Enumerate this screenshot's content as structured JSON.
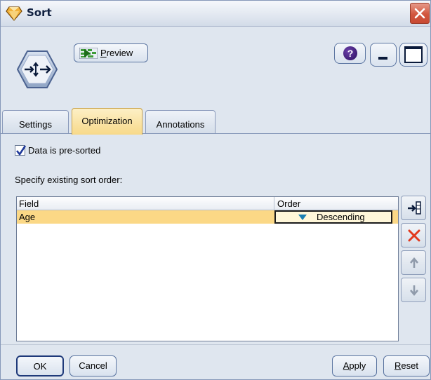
{
  "window": {
    "title": "Sort",
    "icon": "sort-node-icon",
    "close_icon": "close-icon"
  },
  "toolbar": {
    "preview_label_prefix": "",
    "preview_label_underlined": "P",
    "preview_label_rest": "review",
    "help_glyph": "?"
  },
  "tabs": [
    {
      "label": "Settings",
      "active": false
    },
    {
      "label": "Optimization",
      "active": true
    },
    {
      "label": "Annotations",
      "active": false
    }
  ],
  "optimization": {
    "presorted_label": "Data is pre-sorted",
    "presorted_checked": true,
    "sort_order_label": "Specify existing sort order:"
  },
  "table": {
    "columns": [
      "Field",
      "Order"
    ],
    "rows": [
      {
        "field": "Age",
        "order": "Descending"
      }
    ]
  },
  "buttons": {
    "ok": "OK",
    "cancel": "Cancel",
    "apply_underlined": "A",
    "apply_rest": "pply",
    "reset_underlined": "R",
    "reset_rest": "eset"
  },
  "colors": {
    "active_tab": "#f7d98a",
    "selected_row": "#fbd886",
    "background": "#dfe6ef",
    "close_button": "#d2563e"
  }
}
